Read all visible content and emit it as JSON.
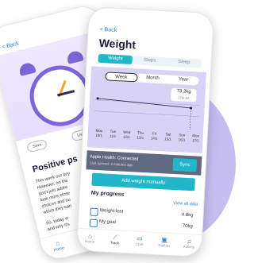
{
  "back_phone": {
    "back_label": "< Back",
    "save_label": "Save",
    "listen_label": "Liste",
    "title": "Positive ps",
    "paragraph1": [
      "This week our key",
      "However, on the",
      "don't just addre",
      "look more close",
      "choices and ou",
      "which they can"
    ],
    "paragraph2": [
      "So, today w",
      "and why it's"
    ],
    "tabs": [
      {
        "label": "Home"
      }
    ]
  },
  "front_phone": {
    "back_label": "< Back",
    "title": "Weight",
    "top_tabs": [
      "Weight",
      "Steps",
      "Sleep"
    ],
    "range_tabs": [
      "Week",
      "Month",
      "Year"
    ],
    "tooltip": {
      "value": "73.2kg",
      "sub": "17th Jul"
    },
    "days": [
      {
        "d": "Mon",
        "n": "10/1"
      },
      {
        "d": "Tue",
        "n": "11/1"
      },
      {
        "d": "Wed",
        "n": "12/1"
      },
      {
        "d": "Thu",
        "n": "13/1"
      },
      {
        "d": "Fri",
        "n": "14/1"
      },
      {
        "d": "Sat",
        "n": "15/1"
      },
      {
        "d": "Sun",
        "n": "16/1"
      },
      {
        "d": "Mon",
        "n": "17/1"
      }
    ],
    "health": {
      "title": "Apple Health: Connected",
      "subtitle": "Last synced: 4 minutes ago",
      "sync": "Sync"
    },
    "add_button": "Add weight manually",
    "progress_title": "My progress",
    "view_all": "View all data",
    "rows": [
      {
        "label": "Weight lost",
        "value": "4.8kg"
      },
      {
        "label": "My goal",
        "value": "70kg"
      }
    ],
    "tabs": [
      {
        "label": "Home",
        "icon": "⌂"
      },
      {
        "label": "Track",
        "icon": "⟋"
      },
      {
        "label": "Chat",
        "icon": "▭"
      },
      {
        "label": "Toolbox",
        "icon": "▣"
      },
      {
        "label": "Activity",
        "icon": "♫"
      }
    ]
  },
  "colors": {
    "accent": "#1fb7c9",
    "purple": "#7b66d9",
    "blob": "#c6bef0"
  }
}
